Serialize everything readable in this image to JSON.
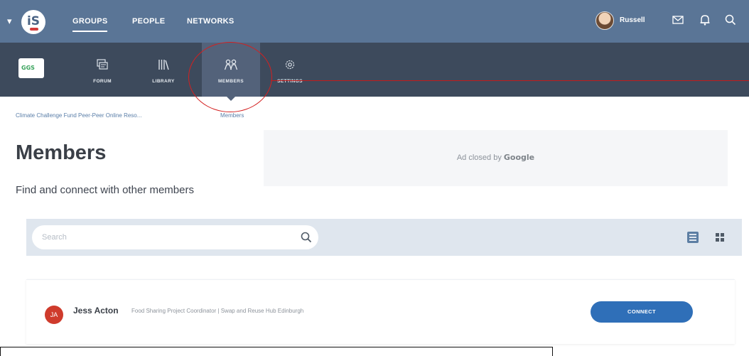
{
  "topbar": {
    "logo_text": "iS",
    "nav": [
      {
        "label": "GROUPS",
        "active": true
      },
      {
        "label": "PEOPLE",
        "active": false
      },
      {
        "label": "NETWORKS",
        "active": false
      }
    ],
    "user_name": "Russell",
    "icons": [
      "chevron-down-icon",
      "mail-icon",
      "bell-icon",
      "search-icon"
    ],
    "bg_color": "#5a7596"
  },
  "groupbar": {
    "group_logo_text": "GGS",
    "tools": [
      {
        "label": "FORUM",
        "icon": "forum-icon",
        "active": false
      },
      {
        "label": "LIBRARY",
        "icon": "library-icon",
        "active": false
      },
      {
        "label": "MEMBERS",
        "icon": "members-icon",
        "active": true
      },
      {
        "label": "SETTINGS",
        "icon": "settings-icon",
        "active": false
      }
    ],
    "bg_color": "#3d4a5c"
  },
  "breadcrumb": {
    "items": [
      "Climate Challenge Fund Peer-Peer Online Reso...",
      "Members"
    ]
  },
  "header": {
    "title": "Members",
    "subtitle": "Find and connect with other members"
  },
  "ad": {
    "prefix": "Ad closed by",
    "brand": "Google"
  },
  "search": {
    "placeholder": "Search"
  },
  "members": [
    {
      "initials": "JA",
      "name": "Jess Acton",
      "role": "Food Sharing Project Coordinator  |  Swap and Reuse Hub Edinburgh",
      "action": "CONNECT",
      "avatar_color": "#cf3b2c"
    }
  ],
  "colors": {
    "accent_button": "#2f6fb8",
    "annotation_red": "#c41a1a",
    "search_strip": "#dfe6ee"
  }
}
